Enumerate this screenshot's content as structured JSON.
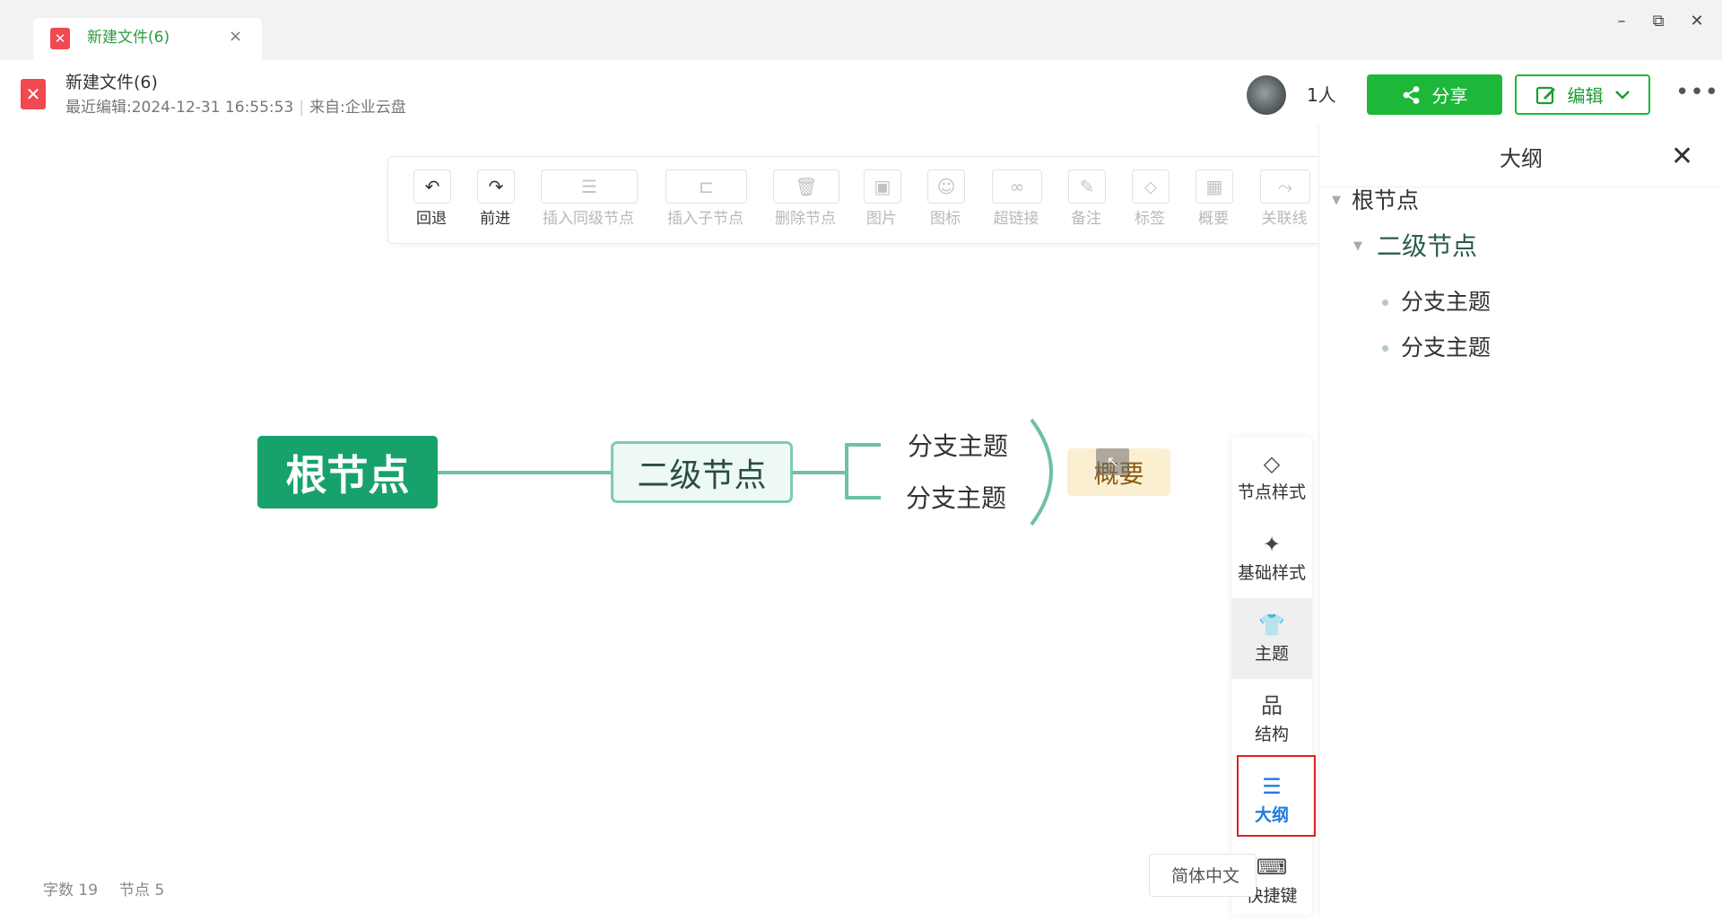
{
  "tab": {
    "title": "新建文件(6)",
    "close": "×",
    "logo": "✕"
  },
  "window_controls": {
    "minimize": "–",
    "restore": "⧉",
    "close": "✕"
  },
  "header": {
    "doc_title": "新建文件(6)",
    "last_edit_label": "最近编辑:",
    "last_edit_time": "2024-12-31 16:55:53",
    "source_label": "来自:",
    "source_value": "企业云盘",
    "collaborators": "1人",
    "share_label": "分享",
    "edit_label": "编辑",
    "more": "•••"
  },
  "toolbar": {
    "items": [
      {
        "label": "回退",
        "icon": "undo-icon",
        "enabled": true
      },
      {
        "label": "前进",
        "icon": "redo-icon",
        "enabled": true
      },
      {
        "label": "插入同级节点",
        "icon": "insert-sibling-icon",
        "enabled": false
      },
      {
        "label": "插入子节点",
        "icon": "insert-child-icon",
        "enabled": false
      },
      {
        "label": "删除节点",
        "icon": "trash-icon",
        "enabled": false
      },
      {
        "label": "图片",
        "icon": "image-icon",
        "enabled": false
      },
      {
        "label": "图标",
        "icon": "smiley-icon",
        "enabled": false
      },
      {
        "label": "超链接",
        "icon": "link-icon",
        "enabled": false
      },
      {
        "label": "备注",
        "icon": "note-icon",
        "enabled": false
      },
      {
        "label": "标签",
        "icon": "tag-icon",
        "enabled": false
      },
      {
        "label": "概要",
        "icon": "summary-grid-icon",
        "enabled": false
      },
      {
        "label": "关联线",
        "icon": "relation-line-icon",
        "enabled": false
      }
    ]
  },
  "mindmap": {
    "root": "根节点",
    "second": "二级节点",
    "branches": [
      "分支主题",
      "分支主题"
    ],
    "summary": "概要"
  },
  "side_tools": {
    "node_style": "节点样式",
    "base_style": "基础样式",
    "theme": "主题",
    "structure": "结构",
    "outline": "大纲",
    "shortcuts": "快捷键"
  },
  "status": {
    "chars_label": "字数",
    "chars": "19",
    "nodes_label": "节点",
    "nodes": "5",
    "language": "简体中文"
  },
  "outline_panel": {
    "title": "大纲",
    "close": "✕",
    "root": "根节点",
    "second": "二级节点",
    "branches": [
      "分支主题",
      "分支主题"
    ]
  },
  "colors": {
    "brand_green": "#1db83a",
    "root_node": "#18a26b",
    "outline_active": "#1e7be0",
    "highlight_border": "#e02020"
  }
}
